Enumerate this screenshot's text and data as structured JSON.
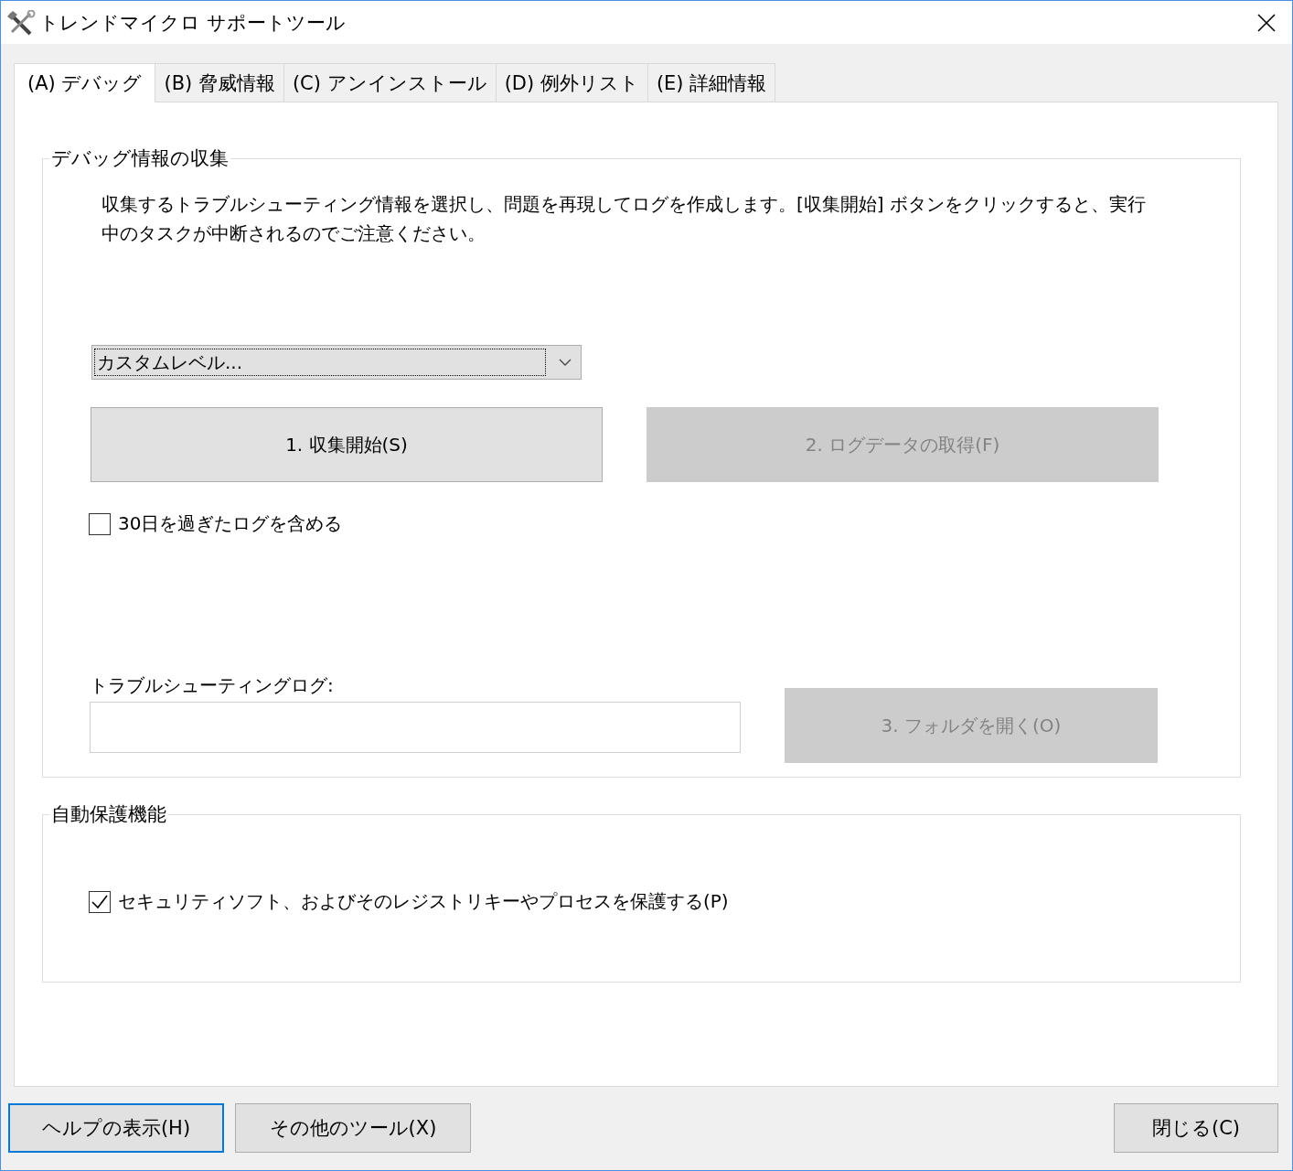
{
  "window": {
    "title": "トレンドマイクロ サポートツール"
  },
  "tabs": [
    {
      "label": "(A) デバッグ",
      "selected": true
    },
    {
      "label": "(B) 脅威情報",
      "selected": false
    },
    {
      "label": "(C) アンインストール",
      "selected": false
    },
    {
      "label": "(D) 例外リスト",
      "selected": false
    },
    {
      "label": "(E) 詳細情報",
      "selected": false
    }
  ],
  "debug_group": {
    "title": "デバッグ情報の収集",
    "description": "収集するトラブルシューティング情報を選択し、問題を再現してログを作成します。[収集開始] ボタンをクリックすると、実行中のタスクが中断されるのでご注意ください。",
    "level_dropdown": {
      "value": "カスタムレベル..."
    },
    "buttons": [
      {
        "label": "1. 収集開始(S)",
        "disabled": false
      },
      {
        "label": "2. ログデータの取得(F)",
        "disabled": true
      }
    ],
    "old_logs_checkbox": {
      "label": "30日を過ぎたログを含める",
      "checked": false
    },
    "log_label": "トラブルシューティングログ:",
    "open_folder_button": {
      "label": "3. フォルダを開く(O)",
      "disabled": true
    }
  },
  "protection_group": {
    "title": "自動保護機能",
    "checkbox": {
      "label": "セキュリティソフト、およびそのレジストリキーやプロセスを保護する(P)",
      "checked": true
    }
  },
  "footer": {
    "left_buttons": [
      {
        "label": "ヘルプの表示(H)",
        "focused": true
      },
      {
        "label": "その他のツール(X)",
        "focused": false
      }
    ],
    "right_buttons": [
      {
        "label": "閉じる(C)",
        "focused": false
      }
    ]
  }
}
